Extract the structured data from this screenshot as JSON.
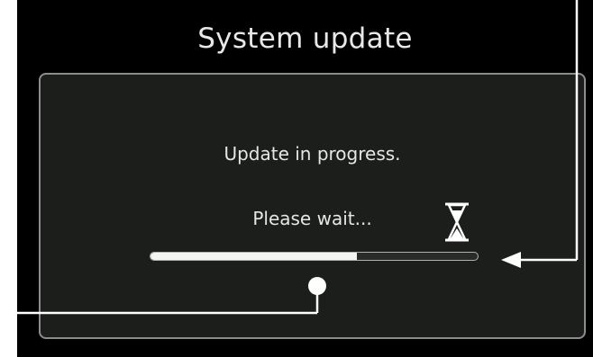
{
  "screen": {
    "title": "System update"
  },
  "dialog": {
    "message_line1": "Update in progress.",
    "message_line2": "Please wait..."
  },
  "progress": {
    "fraction": 0.63
  },
  "icons": {
    "busy": "hourglass-icon"
  },
  "colors": {
    "background": "#000000",
    "dialog_background": "#1c1e1c",
    "dialog_border": "#8c8c8c",
    "text": "#e6e6e6",
    "progress_fill": "#f4f4f4",
    "callout": "#ffffff"
  }
}
